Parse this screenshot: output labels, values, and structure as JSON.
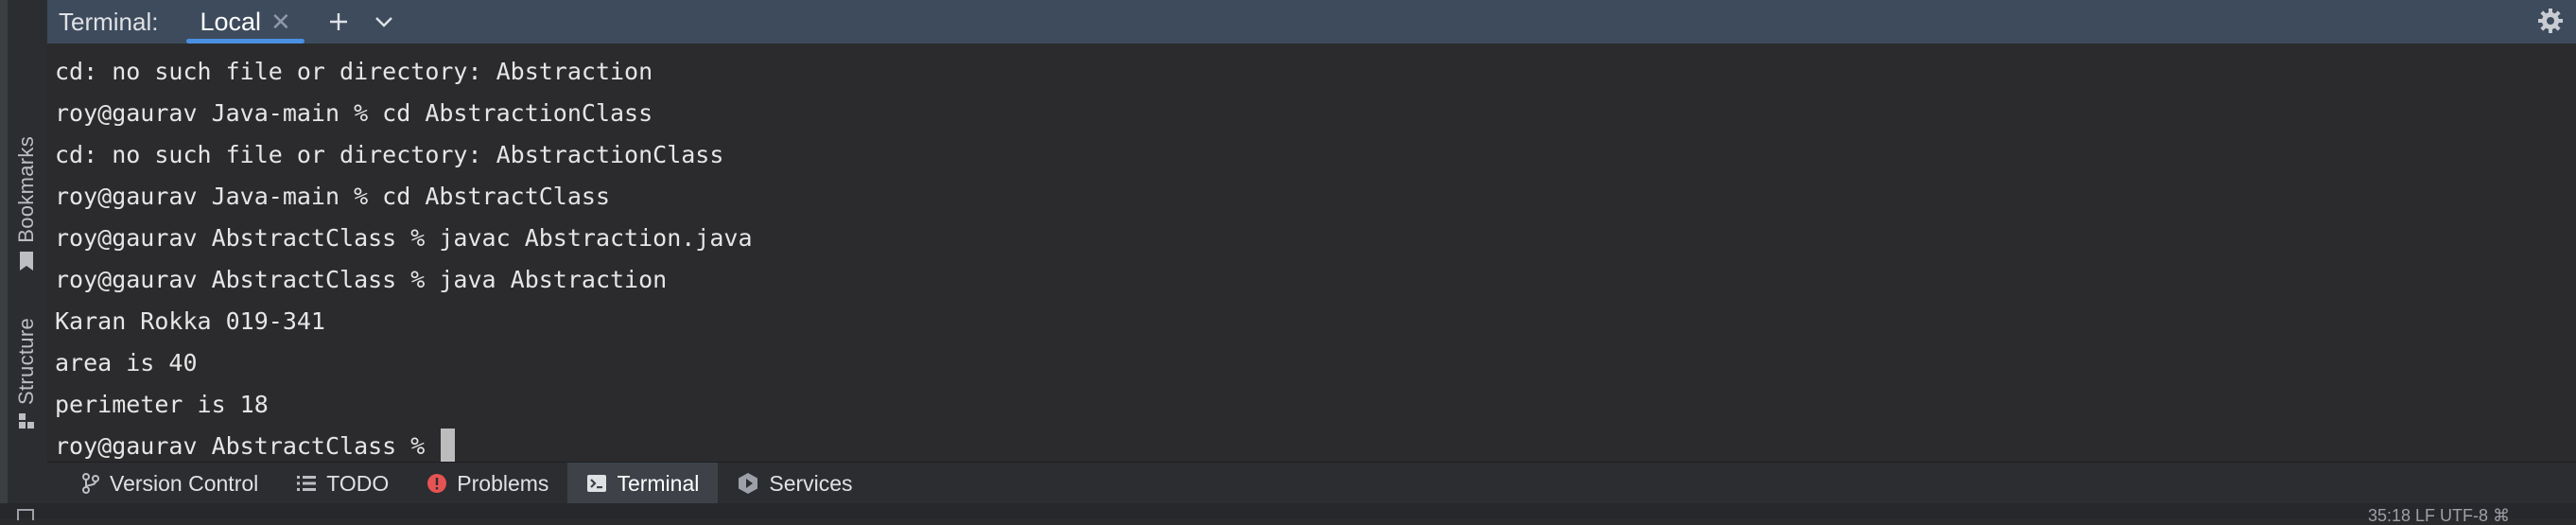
{
  "header": {
    "title": "Terminal:",
    "tab_label": "Local"
  },
  "left_toolbar": {
    "bookmarks_label": "Bookmarks",
    "structure_label": "Structure"
  },
  "terminal": {
    "lines": [
      "cd: no such file or directory: Abstraction",
      "roy@gaurav Java-main % cd AbstractionClass",
      "cd: no such file or directory: AbstractionClass",
      "roy@gaurav Java-main % cd AbstractClass",
      "roy@gaurav AbstractClass % javac Abstraction.java",
      "roy@gaurav AbstractClass % java Abstraction",
      "Karan Rokka 019-341",
      "area is 40",
      "perimeter is 18"
    ],
    "prompt": "roy@gaurav AbstractClass % "
  },
  "bottom_bar": {
    "tabs": [
      {
        "label": "Version Control",
        "icon": "branch-icon"
      },
      {
        "label": "TODO",
        "icon": "list-icon"
      },
      {
        "label": "Problems",
        "icon": "error-icon"
      },
      {
        "label": "Terminal",
        "icon": "terminal-icon",
        "active": true
      },
      {
        "label": "Services",
        "icon": "services-icon"
      }
    ]
  },
  "status": {
    "text": "35:18   LF   UTF-8   ⌘"
  },
  "colors": {
    "header_bg": "#3d4b5c",
    "tab_underline": "#4a90e2",
    "terminal_bg": "#2b2b2d",
    "problems_icon": "#e55353"
  }
}
